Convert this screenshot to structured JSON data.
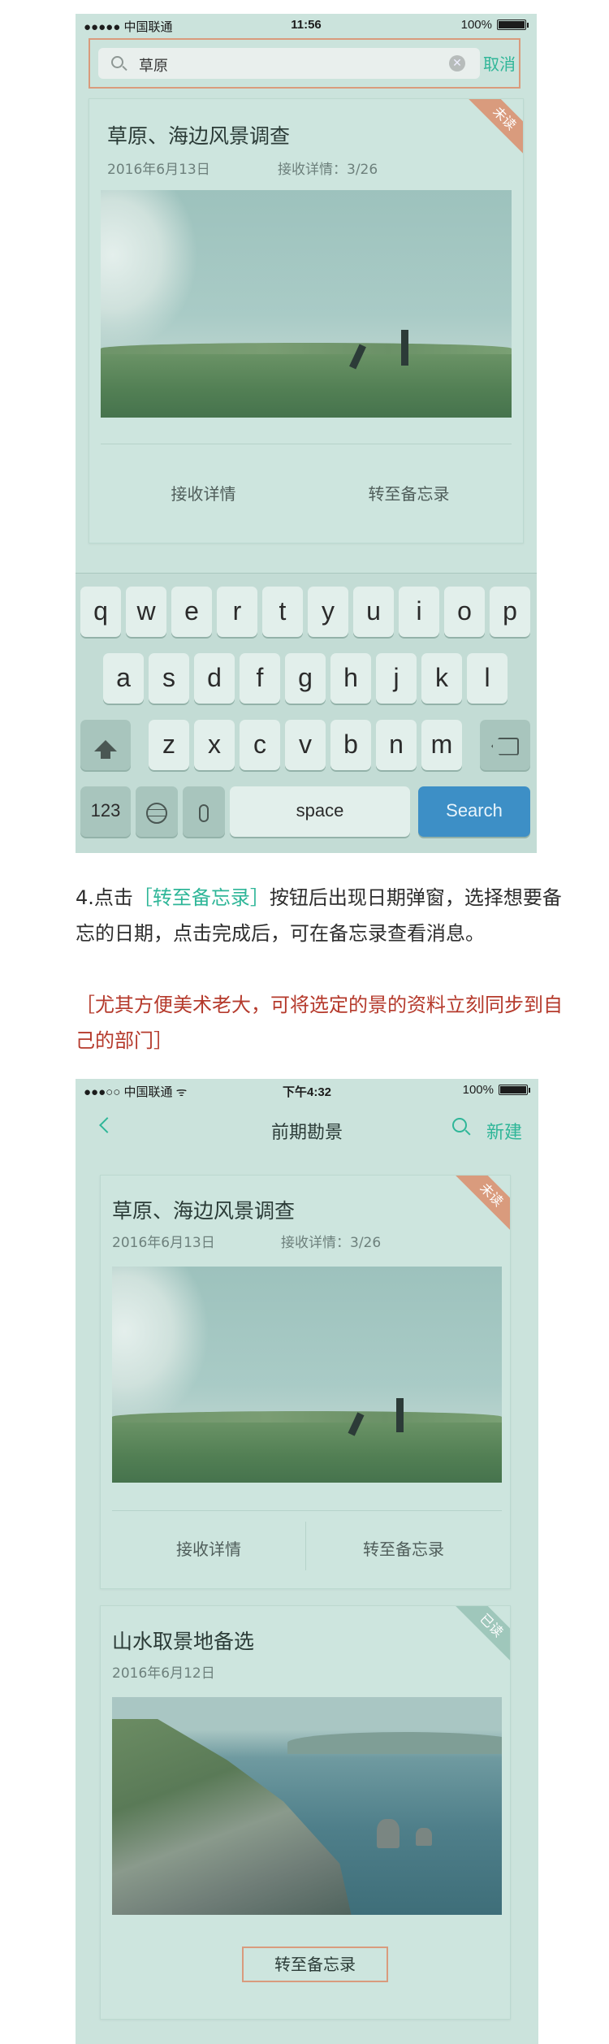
{
  "phone1": {
    "status": {
      "carrier": "●●●●● 中国联通",
      "time": "11:56",
      "battery": "100%"
    },
    "search": {
      "value": "草原",
      "cancel": "取消"
    },
    "card": {
      "title": "草原、海边风景调查",
      "date": "2016年6月13日",
      "receive_info": "接收详情：3/26",
      "badge": "未读",
      "action_left": "接收详情",
      "action_right": "转至备忘录"
    },
    "keyboard": {
      "row1": [
        "q",
        "w",
        "e",
        "r",
        "t",
        "y",
        "u",
        "i",
        "o",
        "p"
      ],
      "row2": [
        "a",
        "s",
        "d",
        "f",
        "g",
        "h",
        "j",
        "k",
        "l"
      ],
      "row3": [
        "z",
        "x",
        "c",
        "v",
        "b",
        "n",
        "m"
      ],
      "num_key": "123",
      "space_key": "space",
      "search_key": "Search"
    }
  },
  "description": {
    "prefix": "4.点击",
    "highlight": "［转至备忘录］",
    "suffix": "按钮后出现日期弹窗，选择想要备忘的日期，点击完成后，可在备忘录查看消息。",
    "note": "［尤其方便美术老大，可将选定的景的资料立刻同步到自己的部门］"
  },
  "phone2": {
    "status": {
      "carrier": "●●●○○ 中国联通 ᯤ",
      "time": "下午4:32",
      "battery": "100%"
    },
    "nav": {
      "title": "前期勘景",
      "new": "新建"
    },
    "card1": {
      "title": "草原、海边风景调查",
      "date": "2016年6月13日",
      "receive_info": "接收详情：3/26",
      "badge": "未读",
      "action_left": "接收详情",
      "action_right": "转至备忘录"
    },
    "card2": {
      "title": "山水取景地备选",
      "date": "2016年6月12日",
      "badge": "已读",
      "action": "转至备忘录"
    }
  },
  "colors": {
    "accent": "#2fb698",
    "unread_badge": "#d99b7d",
    "read_badge": "#9fc7bb",
    "search_key": "#3d8fc6",
    "note_text": "#b53a2c"
  }
}
